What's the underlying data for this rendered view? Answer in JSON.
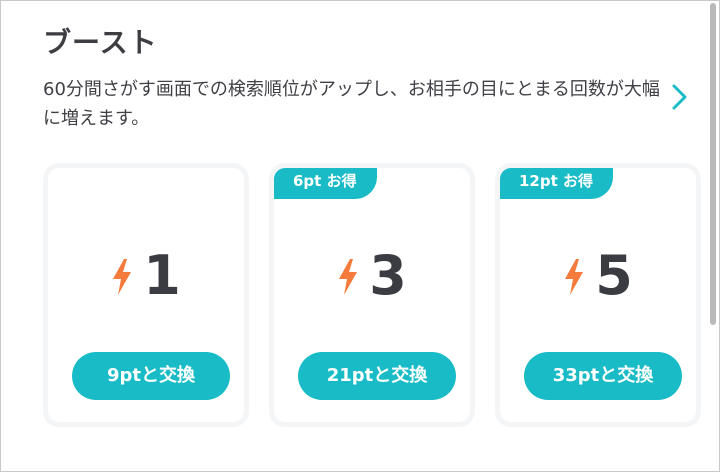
{
  "header": {
    "title": "ブースト",
    "description": "60分間さがす画面での検索順位がアップし、お相手の目にとまる回数が大幅に増えます。",
    "detail_icon": "chevron-right-icon"
  },
  "colors": {
    "accent": "#19bcc6",
    "bolt": "#f47b3c",
    "text": "#3f3f45"
  },
  "options": [
    {
      "badge": "",
      "icon": "lightning-bolt-icon",
      "count": "1",
      "button_label": "9ptと交換"
    },
    {
      "badge": "6pt お得",
      "icon": "lightning-bolt-icon",
      "count": "3",
      "button_label": "21ptと交換"
    },
    {
      "badge": "12pt お得",
      "icon": "lightning-bolt-icon",
      "count": "5",
      "button_label": "33ptと交換"
    }
  ]
}
